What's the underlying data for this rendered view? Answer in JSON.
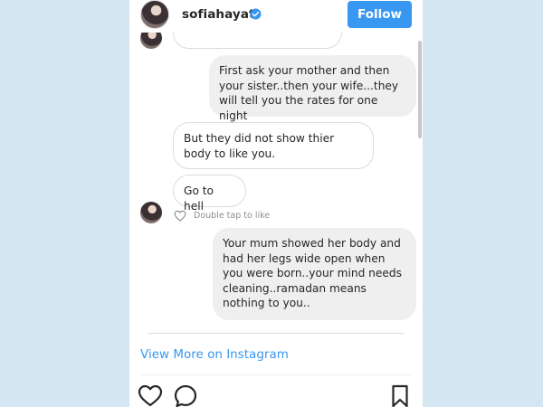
{
  "header": {
    "username": "sofiahayat",
    "follow_label": "Follow",
    "verified_icon": "verified-badge-icon",
    "accent_color": "#3897f0"
  },
  "messages": [
    {
      "direction": "received",
      "text": ""
    },
    {
      "direction": "sent",
      "text": "First ask your mother and then your sister..then your wife...they will tell you the rates for one night"
    },
    {
      "direction": "received",
      "text": "But they did not show thier body to like you."
    },
    {
      "direction": "received",
      "text": "Go to hell"
    },
    {
      "direction": "sent",
      "text": "Your mum showed her body and had her legs wide open when you were born..your mind needs cleaning..ramadan means nothing to you.."
    }
  ],
  "like_hint": {
    "text": "Double tap to like",
    "icon": "heart-outline-icon"
  },
  "footer": {
    "view_more_label": "View More on Instagram",
    "actions": [
      "heart-icon",
      "comment-icon",
      "bookmark-icon"
    ]
  }
}
